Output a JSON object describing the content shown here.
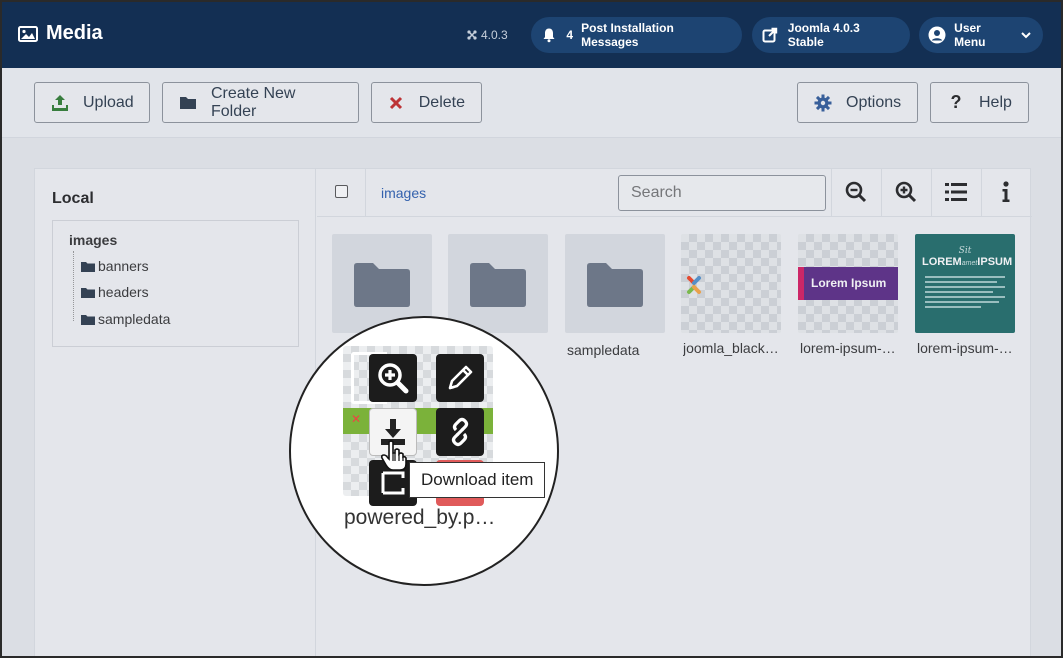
{
  "header": {
    "title": "Media",
    "version": "4.0.3",
    "notifications_count": "4",
    "post_install_label": "Post Installation Messages",
    "joomla_label": "Joomla 4.0.3 Stable",
    "user_menu_label": "User Menu"
  },
  "toolbar": {
    "upload_label": "Upload",
    "create_folder_label": "Create New Folder",
    "delete_label": "Delete",
    "options_label": "Options",
    "help_label": "Help"
  },
  "tree": {
    "section_title": "Local",
    "root_label": "images",
    "items": [
      {
        "label": "banners"
      },
      {
        "label": "headers"
      },
      {
        "label": "sampledata"
      }
    ]
  },
  "browser": {
    "breadcrumb": "images",
    "search_placeholder": "Search",
    "tiles": [
      {
        "label": "",
        "kind": "folder"
      },
      {
        "label": "",
        "kind": "folder"
      },
      {
        "label": "sampledata",
        "kind": "folder"
      },
      {
        "label": "joomla_black…",
        "kind": "image"
      },
      {
        "label": "lorem-ipsum-…",
        "kind": "image"
      },
      {
        "label": "lorem-ipsum-…",
        "kind": "image"
      }
    ],
    "banner_text": "Lorem Ipsum",
    "poster_script": "Sit",
    "poster_lorem": "LOREM",
    "poster_amet": "amet",
    "poster_ipsum": "IPSUM"
  },
  "magnifier": {
    "file_label": "powered_by.p…",
    "tooltip": "Download item"
  },
  "colors": {
    "header_bg": "#132f53",
    "pill_bg": "#1d4472",
    "upload_green": "#2f7d32",
    "delete_red": "#c62828",
    "options_blue": "#2f5b9a",
    "banner_purple": "#5b2a86",
    "banner_pink": "#d81b60",
    "poster_teal": "#1e6b68"
  }
}
